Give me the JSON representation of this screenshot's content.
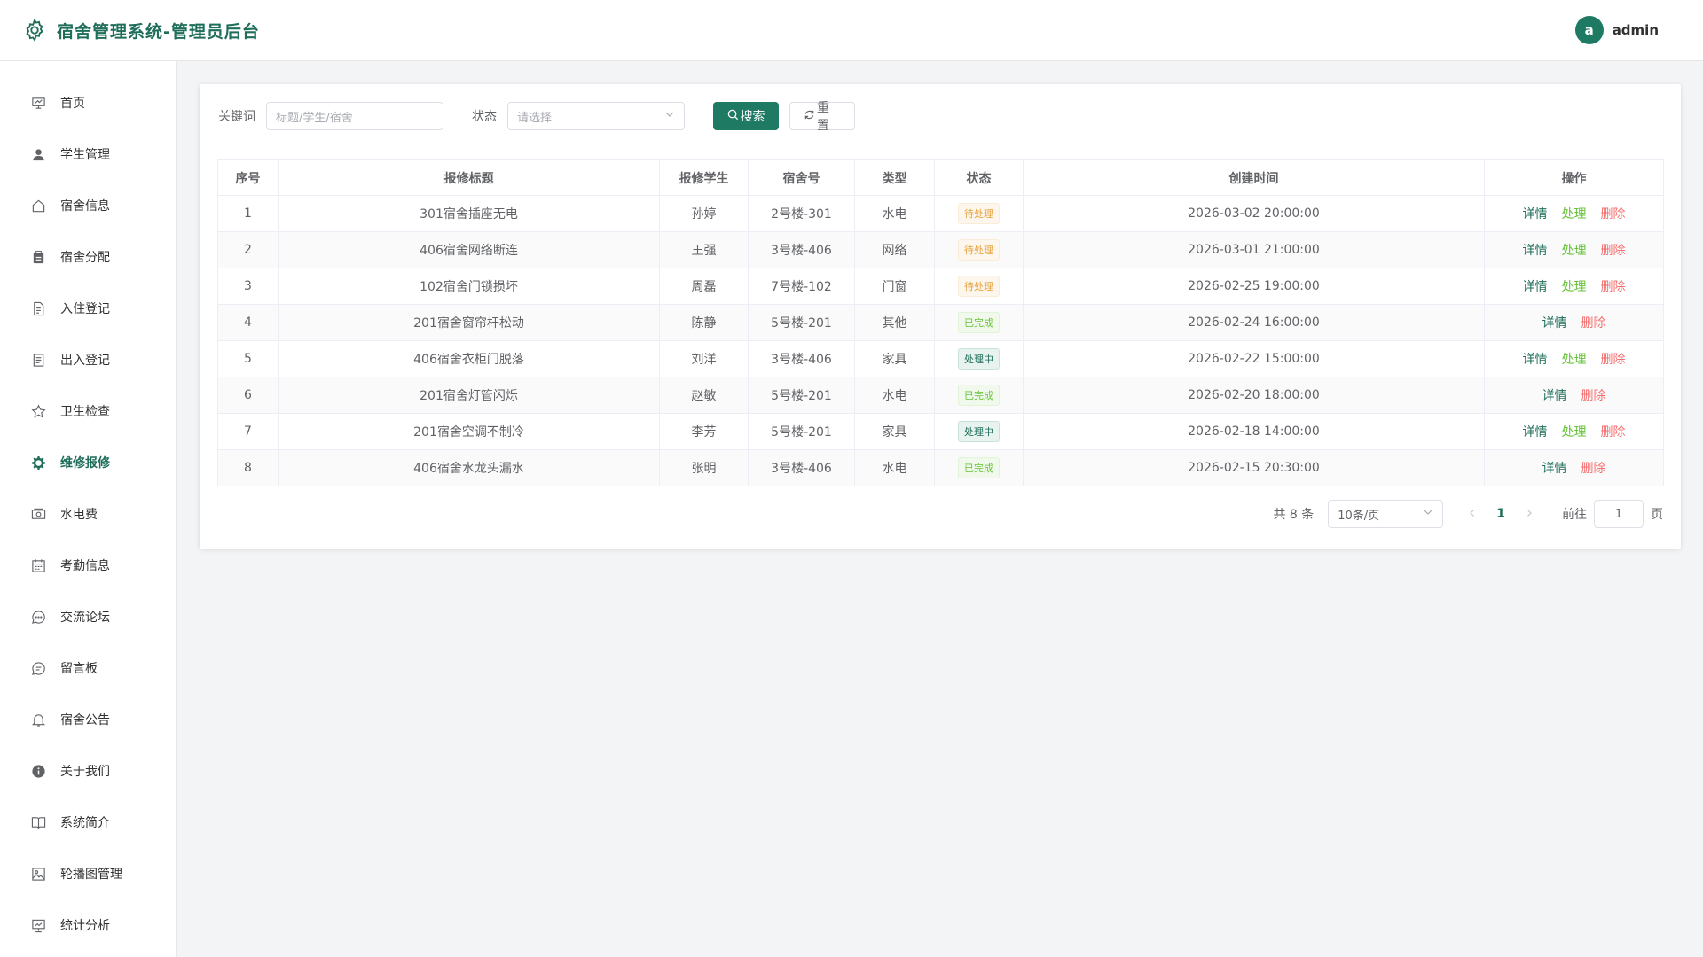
{
  "header": {
    "title": "宿舍管理系统-管理员后台",
    "avatar_letter": "a",
    "username": "admin",
    "logo_icon": "gear-icon"
  },
  "sidebar": {
    "items": [
      {
        "label": "首页",
        "icon": "presentation-icon",
        "active": false
      },
      {
        "label": "学生管理",
        "icon": "user-icon",
        "active": false
      },
      {
        "label": "宿舍信息",
        "icon": "house-icon",
        "active": false
      },
      {
        "label": "宿舍分配",
        "icon": "clipboard-icon",
        "active": false
      },
      {
        "label": "入住登记",
        "icon": "document-icon",
        "active": false
      },
      {
        "label": "出入登记",
        "icon": "tickets-icon",
        "active": false
      },
      {
        "label": "卫生检查",
        "icon": "star-icon",
        "active": false
      },
      {
        "label": "维修报修",
        "icon": "gear-icon",
        "active": true
      },
      {
        "label": "水电费",
        "icon": "money-icon",
        "active": false
      },
      {
        "label": "考勤信息",
        "icon": "calendar-icon",
        "active": false
      },
      {
        "label": "交流论坛",
        "icon": "chat-dots-icon",
        "active": false
      },
      {
        "label": "留言板",
        "icon": "chat-line-icon",
        "active": false
      },
      {
        "label": "宿舍公告",
        "icon": "bell-icon",
        "active": false
      },
      {
        "label": "关于我们",
        "icon": "info-icon",
        "active": false
      },
      {
        "label": "系统简介",
        "icon": "book-icon",
        "active": false
      },
      {
        "label": "轮播图管理",
        "icon": "picture-icon",
        "active": false
      },
      {
        "label": "统计分析",
        "icon": "data-board-icon",
        "active": false
      }
    ]
  },
  "search": {
    "keyword_label": "关键词",
    "keyword_placeholder": "标题/学生/宿舍",
    "status_label": "状态",
    "status_placeholder": "请选择",
    "search_button": "搜索",
    "reset_button": "重置"
  },
  "table": {
    "headers": [
      "序号",
      "报修标题",
      "报修学生",
      "宿舍号",
      "类型",
      "状态",
      "创建时间",
      "操作"
    ],
    "rows": [
      {
        "no": "1",
        "title": "301宿舍插座无电",
        "student": "孙婷",
        "room": "2号楼-301",
        "type": "水电",
        "status": "待处理",
        "status_kind": "pending",
        "time": "2026-03-02 20:00:00",
        "ops": [
          "详情",
          "处理",
          "删除"
        ]
      },
      {
        "no": "2",
        "title": "406宿舍网络断连",
        "student": "王强",
        "room": "3号楼-406",
        "type": "网络",
        "status": "待处理",
        "status_kind": "pending",
        "time": "2026-03-01 21:00:00",
        "ops": [
          "详情",
          "处理",
          "删除"
        ]
      },
      {
        "no": "3",
        "title": "102宿舍门锁损坏",
        "student": "周磊",
        "room": "7号楼-102",
        "type": "门窗",
        "status": "待处理",
        "status_kind": "pending",
        "time": "2026-02-25 19:00:00",
        "ops": [
          "详情",
          "处理",
          "删除"
        ]
      },
      {
        "no": "4",
        "title": "201宿舍窗帘杆松动",
        "student": "陈静",
        "room": "5号楼-201",
        "type": "其他",
        "status": "已完成",
        "status_kind": "done",
        "time": "2026-02-24 16:00:00",
        "ops": [
          "详情",
          "删除"
        ]
      },
      {
        "no": "5",
        "title": "406宿舍衣柜门脱落",
        "student": "刘洋",
        "room": "3号楼-406",
        "type": "家具",
        "status": "处理中",
        "status_kind": "doing",
        "time": "2026-02-22 15:00:00",
        "ops": [
          "详情",
          "处理",
          "删除"
        ]
      },
      {
        "no": "6",
        "title": "201宿舍灯管闪烁",
        "student": "赵敏",
        "room": "5号楼-201",
        "type": "水电",
        "status": "已完成",
        "status_kind": "done",
        "time": "2026-02-20 18:00:00",
        "ops": [
          "详情",
          "删除"
        ]
      },
      {
        "no": "7",
        "title": "201宿舍空调不制冷",
        "student": "李芳",
        "room": "5号楼-201",
        "type": "家具",
        "status": "处理中",
        "status_kind": "doing",
        "time": "2026-02-18 14:00:00",
        "ops": [
          "详情",
          "处理",
          "删除"
        ]
      },
      {
        "no": "8",
        "title": "406宿舍水龙头漏水",
        "student": "张明",
        "room": "3号楼-406",
        "type": "水电",
        "status": "已完成",
        "status_kind": "done",
        "time": "2026-02-15 20:30:00",
        "ops": [
          "详情",
          "删除"
        ]
      }
    ]
  },
  "pagination": {
    "total_text": "共 8 条",
    "page_size": "10条/页",
    "current_page": "1",
    "goto_label": "前往",
    "goto_value": "1",
    "page_unit": "页"
  },
  "colors": {
    "primary": "#1f7a64",
    "pending": "#e6a23c",
    "done": "#67c23a",
    "danger": "#f56c6c"
  }
}
